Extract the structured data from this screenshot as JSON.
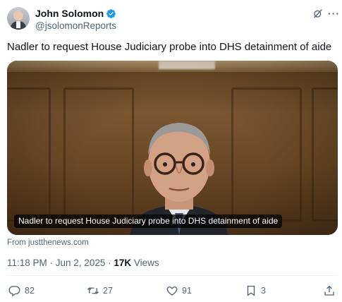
{
  "author": {
    "display_name": "John Solomon",
    "handle": "@jsolomonReports"
  },
  "icons": {
    "verified": "verified-badge-icon",
    "grok": "grok-icon",
    "more": "more-options-icon"
  },
  "tweet": {
    "text": "Nadler to request House Judiciary probe into DHS detainment of aide",
    "media_caption": "Nadler to request House Judiciary probe into DHS detainment of aide",
    "source": "From justthenews.com",
    "timestamp": "11:18 PM · Jun 2, 2025 · ",
    "views_count": "17K",
    "views_label": " Views"
  },
  "actions": {
    "replies": "82",
    "reposts": "27",
    "likes": "91",
    "bookmarks": "3"
  },
  "colors": {
    "verified": "#1d9bf0",
    "secondary_text": "#536471",
    "primary_text": "#0f1419"
  }
}
